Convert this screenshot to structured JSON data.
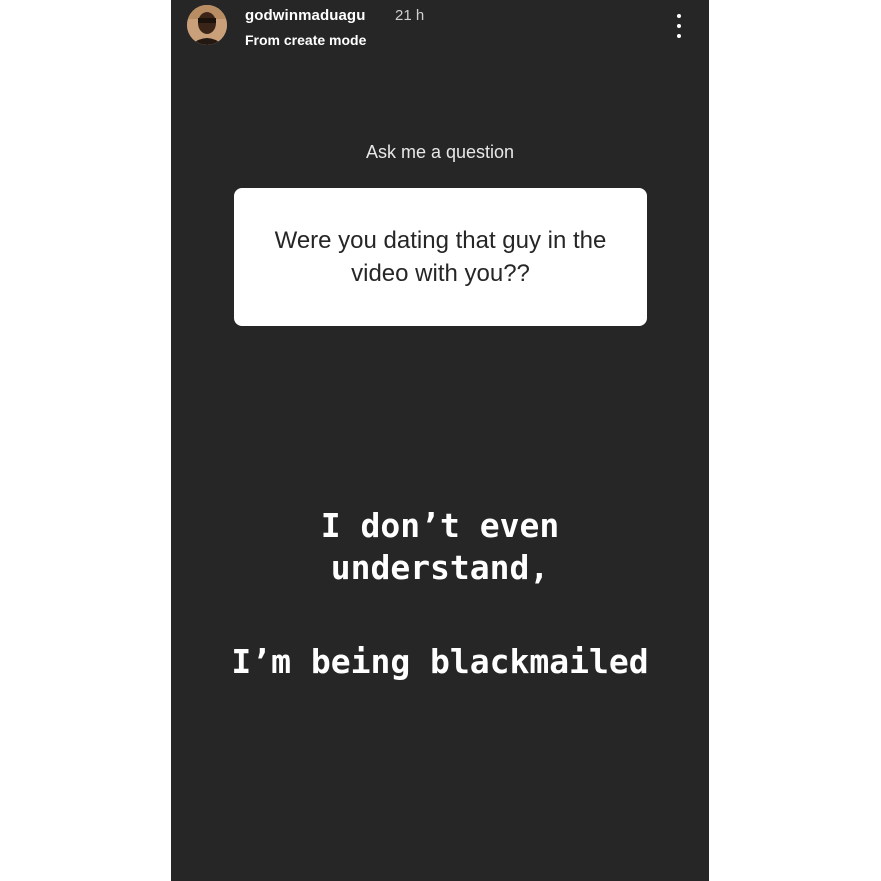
{
  "header": {
    "username": "godwinmaduagu",
    "time": "21 h",
    "subtitle": "From create mode"
  },
  "icons": {
    "avatar": "profile-avatar",
    "more": "more-vertical-icon"
  },
  "question_sticker": {
    "label": "Ask me a question",
    "question": "Were you dating that guy in the video with you??"
  },
  "caption": {
    "line1": "I don’t even",
    "line2": "understand,",
    "line3": "I’m being blackmailed"
  },
  "colors": {
    "story_background": "#262626",
    "card_background": "#ffffff",
    "text": "#ffffff"
  }
}
